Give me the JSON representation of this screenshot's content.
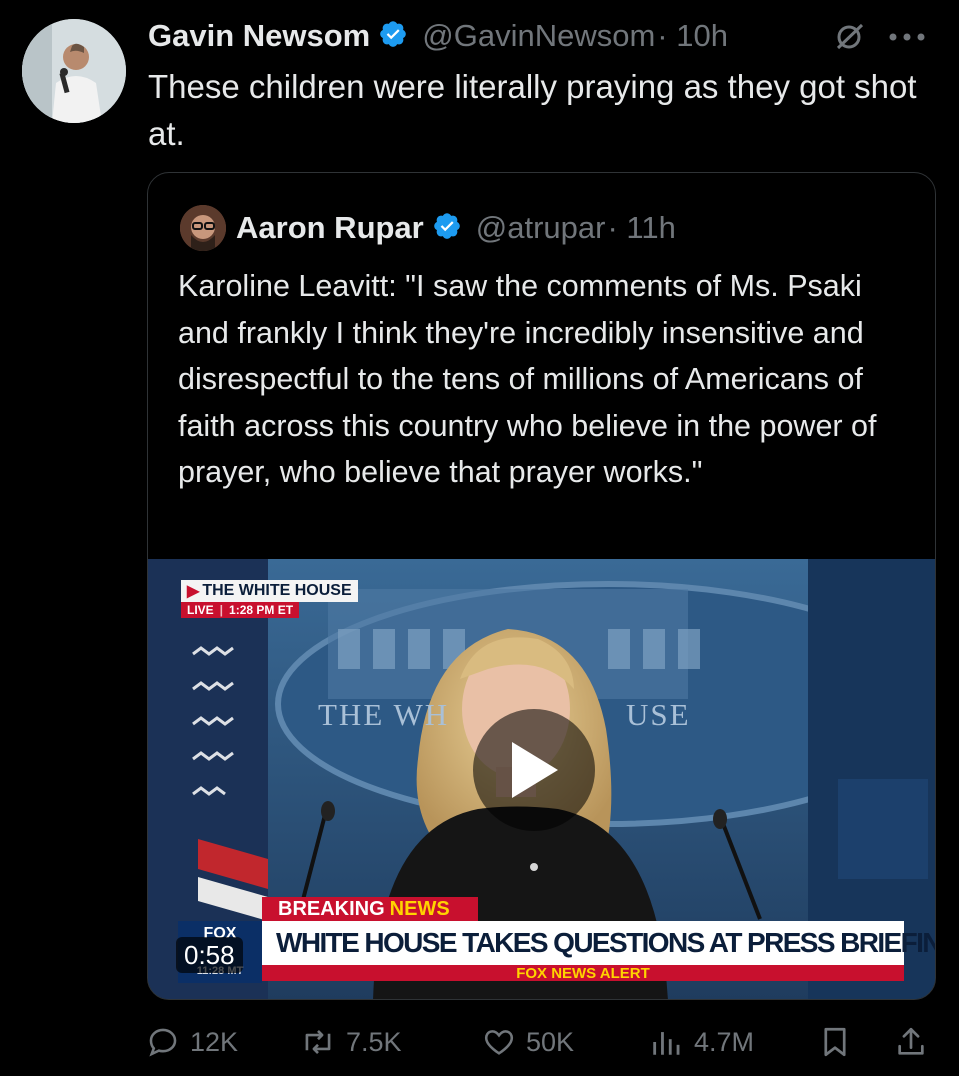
{
  "author": {
    "name": "Gavin Newsom",
    "handle": "@GavinNewsom",
    "time": "· 10h",
    "text": "These children were literally praying as they got shot at."
  },
  "quoted": {
    "name": "Aaron Rupar",
    "handle": "@atrupar",
    "time": "· 11h",
    "text": "Karoline Leavitt: \"I saw the comments of Ms. Psaki and frankly I think they're incredibly insensitive and disrespectful to the tens of millions of Americans of faith across this country who believe in the power of prayer, who believe that prayer works.\"",
    "video": {
      "duration": "0:58",
      "live_label": "THE WHITE HOUSE",
      "live_tag": "LIVE",
      "live_time": "1:28 PM ET",
      "backdrop_left": "THE WH",
      "backdrop_right": "USE",
      "breaking": "BREAKING",
      "news": "NEWS",
      "headline": "WHITE HOUSE TAKES QUESTIONS AT PRESS BRIEFING",
      "fox_alert": "FOX NEWS ALERT",
      "fox_logo": "FOX",
      "fox_time": "11:28 MT"
    }
  },
  "actions": {
    "replies": "12K",
    "reposts": "7.5K",
    "likes": "50K",
    "views": "4.7M"
  },
  "icons": [
    "verified-badge-icon",
    "grok-icon",
    "more-icon",
    "reply-icon",
    "repost-icon",
    "like-icon",
    "views-icon",
    "bookmark-icon",
    "share-icon",
    "play-icon"
  ],
  "colors": {
    "verified": "#1d9bf0",
    "muted": "#71767b",
    "text": "#e7e9ea",
    "background": "#000000"
  }
}
